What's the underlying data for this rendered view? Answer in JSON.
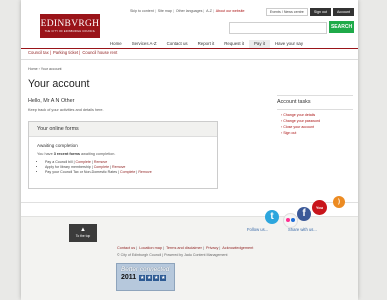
{
  "utility": {
    "links": [
      "Skip to content",
      "Site map",
      "Other languages",
      "A-Z",
      "About our website"
    ]
  },
  "header": {
    "buttons": [
      "Events / News centre",
      "Sign out",
      "Account"
    ],
    "logo_text": "EDINBVRGH",
    "logo_subtext": "THE CITY OF EDINBURGH COUNCIL",
    "search_button": "SEARCH",
    "search_placeholder": ""
  },
  "nav": {
    "items": [
      "Home",
      "Services A-Z",
      "Contact us",
      "Report it",
      "Request it",
      "Pay it",
      "Have your say"
    ],
    "active": "Pay it"
  },
  "quicklinks": [
    "Council tax",
    "Parking ticket",
    "Council house rent"
  ],
  "breadcrumb": "Home › Your account",
  "page_title": "Your account",
  "greeting": "Hello, Mr A N Other",
  "intro": "Keep track of your activities and details here.",
  "online_forms": {
    "title": "Your online forms",
    "subtitle": "Awaiting completion",
    "message_prefix": "You have ",
    "message_strong": "3 recent forms",
    "message_suffix": " awaiting completion.",
    "items": [
      {
        "text": "Pay a Council bill",
        "complete": "Complete",
        "remove": "Remove"
      },
      {
        "text": "Apply for library membership",
        "complete": "Complete",
        "remove": "Remove"
      },
      {
        "text": "Pay your Council Tax or Non-Domestic Rates",
        "complete": "Complete",
        "remove": "Remove"
      }
    ]
  },
  "account_tasks": {
    "title": "Account tasks",
    "items": [
      "Change your details",
      "Change your password",
      "Close your account",
      "Sign out"
    ]
  },
  "footer": {
    "to_top": "To the top",
    "links": [
      "Contact us",
      "Location map",
      "Terms and disclaimer",
      "Privacy",
      "Acknowledgement"
    ],
    "copyright": "© City of Edinburgh Council | Powered by Jadu Content Management",
    "follow": "Follow us...",
    "share": "Share with us...",
    "badge_title": "Better connected",
    "badge_year": "2011",
    "badge_stars": 4,
    "social_icons": [
      "twitter-icon",
      "flickr-icon",
      "facebook-icon",
      "youtube-icon",
      "rss-icon"
    ]
  }
}
